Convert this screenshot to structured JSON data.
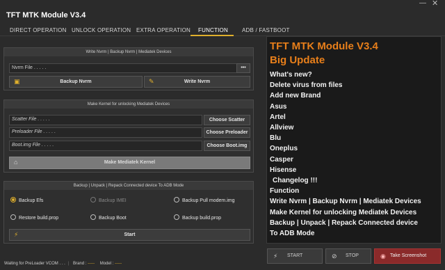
{
  "app": {
    "title": "TFT MTK Module V3.4"
  },
  "window": {
    "minimize_icon": "minimize-icon",
    "close_icon": "close-icon"
  },
  "tabs": [
    {
      "label": "DIRECT OPERATION"
    },
    {
      "label": "UNLOCK OPERATION"
    },
    {
      "label": "EXTRA OPERATION"
    },
    {
      "label": "FUNCTION",
      "active": true
    },
    {
      "label": "ADB / FASTBOOT"
    }
  ],
  "nvrm_panel": {
    "header": "Write Nvrm | Backup Nvrm | Mediatek Devices",
    "file_field": "Nvrm File . . . . .",
    "browse_label": "•••",
    "backup_label": "Backup Nvrm",
    "write_label": "Write Nvrm"
  },
  "kernel_panel": {
    "header": "Make Kernel for unlocking Mediatek Devices",
    "scatter_field": "Scatter File . . . . .",
    "scatter_button": "Choose Scatter",
    "preloader_field": "Preloader File . . . . .",
    "preloader_button": "Choose Preloader",
    "boot_field": "Boot.img File . . . . .",
    "boot_button": "Choose Boot.img",
    "make_label": "Make Mediatek Kernel"
  },
  "backup_panel": {
    "header": "Backup | Unpack | Repack  Connected device To ADB Mode",
    "options": [
      {
        "label": "Backup Efs",
        "checked": true,
        "enabled": true
      },
      {
        "label": "Backup IMEI",
        "checked": false,
        "enabled": false
      },
      {
        "label": "Backup Pull modem.img",
        "checked": false,
        "enabled": true
      },
      {
        "label": "Restore build.prop",
        "checked": false,
        "enabled": true
      },
      {
        "label": "Backup Boot",
        "checked": false,
        "enabled": true
      },
      {
        "label": "Backup build.prop",
        "checked": false,
        "enabled": true
      }
    ],
    "start_label": "Start"
  },
  "status": {
    "message": "Waiting for PreLoader VCOM . . .",
    "brand_label": "Brand :",
    "brand_value": "-----",
    "model_label": "Model :",
    "model_value": "-----"
  },
  "changelog": {
    "title_1": "TFT MTK Module V3.4",
    "title_2": "Big Update",
    "lines": [
      "What's new?",
      "Delete virus from files",
      "Add new Brand",
      "Asus",
      "Artel",
      "Allview",
      "Blu",
      "Oneplus",
      "Casper",
      "Hisense",
      " Changelog !!!",
      "Function",
      "Write Nvrm  |  Backup Nvrm  |  Mediatek Devices",
      "Make Kernel for unlocking Mediatek Devices",
      "Backup  |  Unpack  |  Repack  Connected device",
      "To ADB Mode"
    ]
  },
  "bottom_buttons": {
    "start_label": "START",
    "stop_label": "STOP",
    "screenshot_label": "Take Screenshot"
  },
  "colors": {
    "accent": "#e0b02c",
    "changelog_title": "#e87f1a",
    "screenshot_button": "#8a2a2a"
  }
}
